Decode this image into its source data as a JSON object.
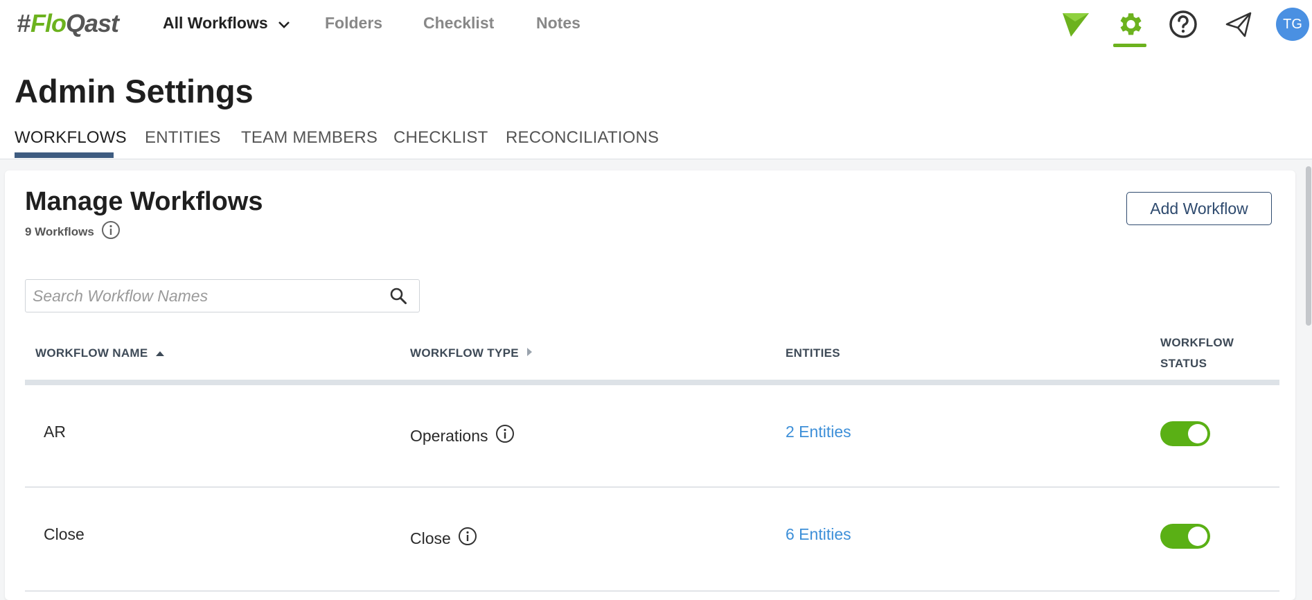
{
  "colors": {
    "brand_green": "#6cb21e",
    "toggle_on": "#5ab015",
    "link_blue": "#3d8fd8",
    "nav_blue": "#3e5c80",
    "avatar_blue": "#4a90e2"
  },
  "topbar": {
    "logo": {
      "hash": "#",
      "flo": "Flo",
      "qast": "Qast"
    },
    "nav": {
      "all_workflows": "All Workflows",
      "folders": "Folders",
      "checklist": "Checklist",
      "notes": "Notes"
    },
    "icons": [
      "floqast-arrow-icon",
      "gear-icon",
      "help-icon",
      "send-icon"
    ],
    "avatar_initials": "TG"
  },
  "header": {
    "title": "Admin Settings",
    "tabs": [
      {
        "label": "WORKFLOWS",
        "active": true
      },
      {
        "label": "ENTITIES",
        "active": false
      },
      {
        "label": "TEAM MEMBERS",
        "active": false
      },
      {
        "label": "CHECKLIST",
        "active": false
      },
      {
        "label": "RECONCILIATIONS",
        "active": false
      }
    ]
  },
  "main": {
    "title": "Manage Workflows",
    "count": "9 Workflows",
    "add_button": "Add Workflow",
    "search": {
      "placeholder": "Search Workflow Names",
      "value": ""
    },
    "columns": {
      "name": "WORKFLOW NAME",
      "type": "WORKFLOW TYPE",
      "entities": "ENTITIES",
      "status_line1": "WORKFLOW",
      "status_line2": "STATUS"
    },
    "rows": [
      {
        "name": "AR",
        "type": "Operations",
        "entities": "2 Entities",
        "status_on": true
      },
      {
        "name": "Close",
        "type": "Close",
        "entities": "6 Entities",
        "status_on": true
      }
    ]
  }
}
